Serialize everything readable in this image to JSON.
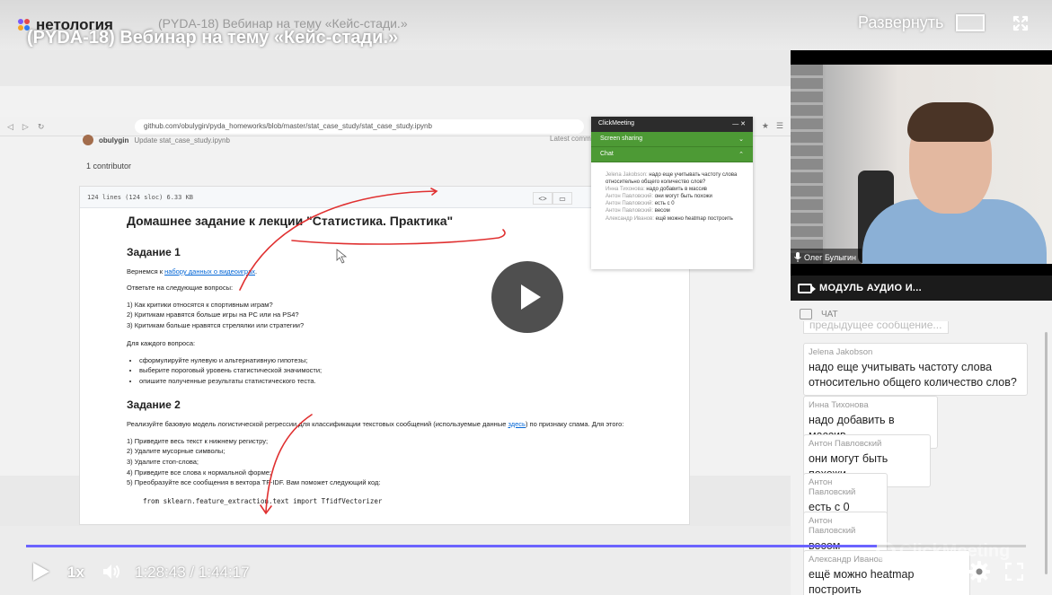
{
  "top_bar": {
    "logo_text": "нетология",
    "tab_title": "(PYDA-18) Вебинар на тему «Кейс-стади.»",
    "video_title": "(PYDA-18) Вебинар на тему «Кейс-стади.»",
    "expand_label": "Развернуть"
  },
  "browser": {
    "url": "github.com/obulygin/pyda_homeworks/blob/master/stat_case_study/stat_case_study.ipynb"
  },
  "github": {
    "user": "obulygin",
    "commit_message": "Update stat_case_study.ipynb",
    "latest_commit": "Latest comm",
    "contributors": "1 contributor",
    "file_info": "124 lines (124 sloc)    6.33 KB"
  },
  "notebook": {
    "title": "Домашнее задание к лекции \"Статистика. Практика\"",
    "task1_heading": "Задание 1",
    "task1_intro_prefix": "Вернемся к ",
    "task1_intro_link": "набору данных о видеоиграх",
    "task1_questions_label": "Ответьте на следующие вопросы:",
    "task1_questions": [
      "1) Как критики относятся к спортивным играм?",
      "2) Критикам нравятся больше игры на PC или на PS4?",
      "3) Критикам больше нравятся стрелялки или стратегии?"
    ],
    "task1_each_label": "Для каждого вопроса:",
    "task1_bullets": [
      "сформулируйте нулевую и альтернативную гипотезы;",
      "выберите пороговый уровень статистической значимости;",
      "опишите полученные результаты статистического теста."
    ],
    "task2_heading": "Задание 2",
    "task2_intro": "Реализуйте базовую модель логистической регрессии для классификации текстовых сообщений (используемые данные ",
    "task2_link": "здесь",
    "task2_intro_end": ") по признаку спама. Для этого:",
    "task2_steps": [
      "1) Приведите весь текст к нижнему регистру;",
      "2) Удалите мусорные символы;",
      "3) Удалите стоп-слова;",
      "4) Приведите все слова к нормальной форме;",
      "5) Преобразуйте все сообщения в вектора TF-IDF. Вам поможет следующий код:"
    ],
    "code_line": "from sklearn.feature_extraction.text import TfidfVectorizer"
  },
  "clickmeeting_widget": {
    "brand": "ClickMeeting",
    "screen_sharing": "Screen sharing",
    "chat": "Chat",
    "messages": [
      {
        "name": "Jelena Jakobson:",
        "text": "надо еще учитывать частоту слова относительно общего количество слов?"
      },
      {
        "name": "Инна Тихонова:",
        "text": "надо добавить в массив"
      },
      {
        "name": "Антон Павловский:",
        "text": "они могут быть похожи"
      },
      {
        "name": "Антон Павловский:",
        "text": "есть с 0"
      },
      {
        "name": "Антон Павловский:",
        "text": "весом"
      },
      {
        "name": "Александр Иванов:",
        "text": "ещё можно heatmap построить"
      }
    ]
  },
  "webcam": {
    "presenter_name": "Олег Булыгин"
  },
  "audio_module": {
    "label": "МОДУЛЬ АУДИО И..."
  },
  "chat": {
    "header": "ЧАТ",
    "partial_text": "предыдущее сообщение...",
    "messages": [
      {
        "name": "Jelena Jakobson",
        "text": "надо еще учитывать частоту слова относительно общего количество слов?"
      },
      {
        "name": "Инна Тихонова",
        "text": "надо добавить в массив"
      },
      {
        "name": "Антон Павловский",
        "text": "они могут быть похожи"
      },
      {
        "name": "Антон Павловский",
        "text": "есть с 0"
      },
      {
        "name": "Антон Павловский",
        "text": "весом"
      },
      {
        "name": "Александр Иванов",
        "text": "ещё можно heatmap построить"
      }
    ]
  },
  "player": {
    "speed": "1x",
    "time": "1:28:43 / 1:44:17",
    "progress_fraction": 0.851,
    "watermark": "ClickMeeting",
    "accent_color": "#6b63ff"
  },
  "icons": [
    "play-icon",
    "volume-icon",
    "settings-gear-icon",
    "fullscreen-icon",
    "expand-rect-icon",
    "camera-icon",
    "chat-icon",
    "microphone-icon"
  ]
}
